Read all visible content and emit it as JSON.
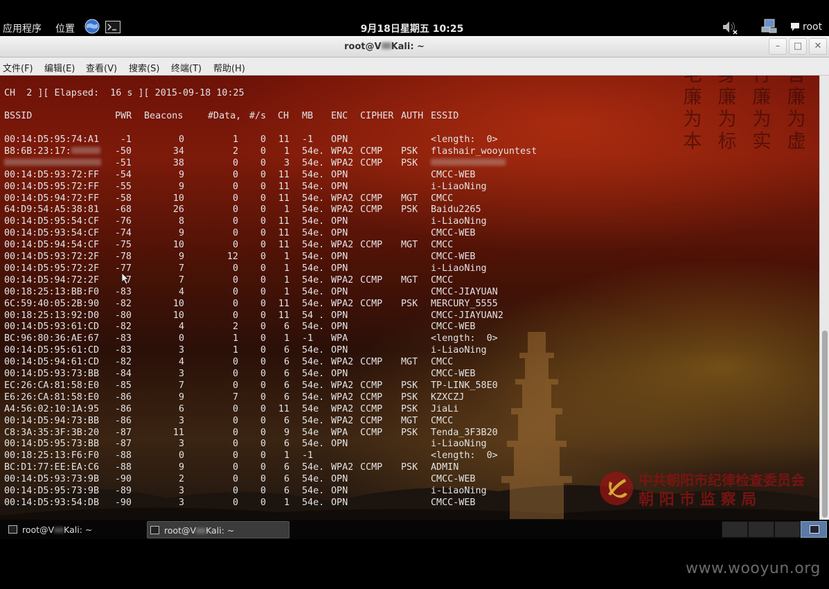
{
  "top_panel": {
    "apps_label": "应用程序",
    "places_label": "位置",
    "clock": "9月18日星期五 10:25",
    "user": "root",
    "icons": [
      "browser-globe-icon",
      "terminal-launcher-icon",
      "volume-muted-icon",
      "network-icon",
      "chat-icon"
    ]
  },
  "window": {
    "title_prefix": "root@V",
    "title_suffix": "Kali: ~",
    "buttons": {
      "minimize": "–",
      "maximize": "□",
      "close": "✕"
    }
  },
  "menu": [
    "文件(F)",
    "编辑(E)",
    "查看(V)",
    "搜索(S)",
    "终端(T)",
    "帮助(H)"
  ],
  "terminal": {
    "status_line": "CH  2 ][ Elapsed:  16 s ][ 2015-09-18 10:25",
    "headers": {
      "bssid": "BSSID",
      "pwr": "PWR",
      "beacons": "Beacons",
      "data": "#Data,",
      "rate": "#/s",
      "ch": "CH",
      "mb": "MB",
      "enc": "ENC",
      "cipher": "CIPHER",
      "auth": "AUTH",
      "essid": "ESSID"
    },
    "rows": [
      {
        "bssid": "00:14:D5:95:74:A1",
        "pwr": "-1",
        "beacons": "0",
        "data": "1",
        "rate": "0",
        "ch": "11",
        "mb": "-1",
        "enc": "OPN",
        "cipher": "",
        "auth": "",
        "essid": "<length:  0>"
      },
      {
        "bssid": "B8:6B:23:17:",
        "bssid_blur": true,
        "pwr": "-50",
        "beacons": "34",
        "data": "2",
        "rate": "0",
        "ch": "1",
        "mb": "54e.",
        "enc": "WPA2",
        "cipher": "CCMP",
        "auth": "PSK",
        "essid": "flashair_wooyuntest"
      },
      {
        "bssid": "",
        "bssid_blur": true,
        "pwr": "-51",
        "beacons": "38",
        "data": "0",
        "rate": "0",
        "ch": "3",
        "mb": "54e.",
        "enc": "WPA2",
        "cipher": "CCMP",
        "auth": "PSK",
        "essid": "",
        "essid_blur": true
      },
      {
        "bssid": "00:14:D5:93:72:FF",
        "pwr": "-54",
        "beacons": "9",
        "data": "0",
        "rate": "0",
        "ch": "11",
        "mb": "54e.",
        "enc": "OPN",
        "cipher": "",
        "auth": "",
        "essid": "CMCC-WEB"
      },
      {
        "bssid": "00:14:D5:95:72:FF",
        "pwr": "-55",
        "beacons": "9",
        "data": "0",
        "rate": "0",
        "ch": "11",
        "mb": "54e.",
        "enc": "OPN",
        "cipher": "",
        "auth": "",
        "essid": "i-LiaoNing"
      },
      {
        "bssid": "00:14:D5:94:72:FF",
        "pwr": "-58",
        "beacons": "10",
        "data": "0",
        "rate": "0",
        "ch": "11",
        "mb": "54e.",
        "enc": "WPA2",
        "cipher": "CCMP",
        "auth": "MGT",
        "essid": "CMCC"
      },
      {
        "bssid": "64:D9:54:A5:38:81",
        "pwr": "-68",
        "beacons": "26",
        "data": "0",
        "rate": "0",
        "ch": "1",
        "mb": "54e.",
        "enc": "WPA2",
        "cipher": "CCMP",
        "auth": "PSK",
        "essid": "Baidu2265"
      },
      {
        "bssid": "00:14:D5:95:54:CF",
        "pwr": "-76",
        "beacons": "8",
        "data": "0",
        "rate": "0",
        "ch": "11",
        "mb": "54e.",
        "enc": "OPN",
        "cipher": "",
        "auth": "",
        "essid": "i-LiaoNing"
      },
      {
        "bssid": "00:14:D5:93:54:CF",
        "pwr": "-74",
        "beacons": "9",
        "data": "0",
        "rate": "0",
        "ch": "11",
        "mb": "54e.",
        "enc": "OPN",
        "cipher": "",
        "auth": "",
        "essid": "CMCC-WEB"
      },
      {
        "bssid": "00:14:D5:94:54:CF",
        "pwr": "-75",
        "beacons": "10",
        "data": "0",
        "rate": "0",
        "ch": "11",
        "mb": "54e.",
        "enc": "WPA2",
        "cipher": "CCMP",
        "auth": "MGT",
        "essid": "CMCC"
      },
      {
        "bssid": "00:14:D5:93:72:2F",
        "pwr": "-78",
        "beacons": "9",
        "data": "12",
        "rate": "0",
        "ch": "1",
        "mb": "54e.",
        "enc": "OPN",
        "cipher": "",
        "auth": "",
        "essid": "CMCC-WEB"
      },
      {
        "bssid": "00:14:D5:95:72:2F",
        "pwr": "-77",
        "beacons": "7",
        "data": "0",
        "rate": "0",
        "ch": "1",
        "mb": "54e.",
        "enc": "OPN",
        "cipher": "",
        "auth": "",
        "essid": "i-LiaoNing"
      },
      {
        "bssid": "00:14:D5:94:72:2F",
        "pwr": "-7",
        "beacons": "7",
        "data": "0",
        "rate": "0",
        "ch": "1",
        "mb": "54e.",
        "enc": "WPA2",
        "cipher": "CCMP",
        "auth": "MGT",
        "essid": "CMCC"
      },
      {
        "bssid": "00:18:25:13:BB:F0",
        "pwr": "-83",
        "beacons": "4",
        "data": "0",
        "rate": "0",
        "ch": "1",
        "mb": "54e.",
        "enc": "OPN",
        "cipher": "",
        "auth": "",
        "essid": "CMCC-JIAYUAN"
      },
      {
        "bssid": "6C:59:40:05:2B:90",
        "pwr": "-82",
        "beacons": "10",
        "data": "0",
        "rate": "0",
        "ch": "11",
        "mb": "54e.",
        "enc": "WPA2",
        "cipher": "CCMP",
        "auth": "PSK",
        "essid": "MERCURY_5555"
      },
      {
        "bssid": "00:18:25:13:92:D0",
        "pwr": "-80",
        "beacons": "10",
        "data": "0",
        "rate": "0",
        "ch": "11",
        "mb": "54 .",
        "enc": "OPN",
        "cipher": "",
        "auth": "",
        "essid": "CMCC-JIAYUAN2"
      },
      {
        "bssid": "00:14:D5:93:61:CD",
        "pwr": "-82",
        "beacons": "4",
        "data": "2",
        "rate": "0",
        "ch": "6",
        "mb": "54e.",
        "enc": "OPN",
        "cipher": "",
        "auth": "",
        "essid": "CMCC-WEB"
      },
      {
        "bssid": "BC:96:80:36:AE:67",
        "pwr": "-83",
        "beacons": "0",
        "data": "1",
        "rate": "0",
        "ch": "1",
        "mb": "-1",
        "enc": "WPA",
        "cipher": "",
        "auth": "",
        "essid": "<length:  0>"
      },
      {
        "bssid": "00:14:D5:95:61:CD",
        "pwr": "-83",
        "beacons": "3",
        "data": "1",
        "rate": "0",
        "ch": "6",
        "mb": "54e.",
        "enc": "OPN",
        "cipher": "",
        "auth": "",
        "essid": "i-LiaoNing"
      },
      {
        "bssid": "00:14:D5:94:61:CD",
        "pwr": "-82",
        "beacons": "4",
        "data": "0",
        "rate": "0",
        "ch": "6",
        "mb": "54e.",
        "enc": "WPA2",
        "cipher": "CCMP",
        "auth": "MGT",
        "essid": "CMCC"
      },
      {
        "bssid": "00:14:D5:93:73:BB",
        "pwr": "-84",
        "beacons": "3",
        "data": "0",
        "rate": "0",
        "ch": "6",
        "mb": "54e.",
        "enc": "OPN",
        "cipher": "",
        "auth": "",
        "essid": "CMCC-WEB"
      },
      {
        "bssid": "EC:26:CA:81:58:E0",
        "pwr": "-85",
        "beacons": "7",
        "data": "0",
        "rate": "0",
        "ch": "6",
        "mb": "54e.",
        "enc": "WPA2",
        "cipher": "CCMP",
        "auth": "PSK",
        "essid": "TP-LINK_58E0"
      },
      {
        "bssid": "E6:26:CA:81:58:E0",
        "pwr": "-86",
        "beacons": "9",
        "data": "7",
        "rate": "0",
        "ch": "6",
        "mb": "54e.",
        "enc": "WPA2",
        "cipher": "CCMP",
        "auth": "PSK",
        "essid": "KZXCZJ"
      },
      {
        "bssid": "A4:56:02:10:1A:95",
        "pwr": "-86",
        "beacons": "6",
        "data": "0",
        "rate": "0",
        "ch": "11",
        "mb": "54e",
        "enc": "WPA2",
        "cipher": "CCMP",
        "auth": "PSK",
        "essid": "JiaLi"
      },
      {
        "bssid": "00:14:D5:94:73:BB",
        "pwr": "-86",
        "beacons": "3",
        "data": "0",
        "rate": "0",
        "ch": "6",
        "mb": "54e.",
        "enc": "WPA2",
        "cipher": "CCMP",
        "auth": "MGT",
        "essid": "CMCC"
      },
      {
        "bssid": "C8:3A:35:3F:3B:20",
        "pwr": "-87",
        "beacons": "11",
        "data": "0",
        "rate": "0",
        "ch": "9",
        "mb": "54e",
        "enc": "WPA",
        "cipher": "CCMP",
        "auth": "PSK",
        "essid": "Tenda_3F3B20"
      },
      {
        "bssid": "00:14:D5:95:73:BB",
        "pwr": "-87",
        "beacons": "3",
        "data": "0",
        "rate": "0",
        "ch": "6",
        "mb": "54e.",
        "enc": "OPN",
        "cipher": "",
        "auth": "",
        "essid": "i-LiaoNing"
      },
      {
        "bssid": "00:18:25:13:F6:F0",
        "pwr": "-88",
        "beacons": "0",
        "data": "0",
        "rate": "0",
        "ch": "1",
        "mb": "-1",
        "enc": "",
        "cipher": "",
        "auth": "",
        "essid": "<length:  0>"
      },
      {
        "bssid": "BC:D1:77:EE:EA:C6",
        "pwr": "-88",
        "beacons": "9",
        "data": "0",
        "rate": "0",
        "ch": "6",
        "mb": "54e.",
        "enc": "WPA2",
        "cipher": "CCMP",
        "auth": "PSK",
        "essid": "ADMIN"
      },
      {
        "bssid": "00:14:D5:93:73:9B",
        "pwr": "-90",
        "beacons": "2",
        "data": "0",
        "rate": "0",
        "ch": "6",
        "mb": "54e.",
        "enc": "OPN",
        "cipher": "",
        "auth": "",
        "essid": "CMCC-WEB"
      },
      {
        "bssid": "00:14:D5:95:73:9B",
        "pwr": "-89",
        "beacons": "3",
        "data": "0",
        "rate": "0",
        "ch": "6",
        "mb": "54e.",
        "enc": "OPN",
        "cipher": "",
        "auth": "",
        "essid": "i-LiaoNing"
      },
      {
        "bssid": "00:14:D5:93:54:DB",
        "pwr": "-90",
        "beacons": "3",
        "data": "0",
        "rate": "0",
        "ch": "1",
        "mb": "54e.",
        "enc": "OPN",
        "cipher": "",
        "auth": "",
        "essid": "CMCC-WEB"
      }
    ]
  },
  "wallpaper": {
    "poster_columns": [
      [
        "毛",
        "廉",
        "为",
        "本"
      ],
      [
        "身",
        "廉",
        "为",
        "标"
      ],
      [
        "行",
        "廉",
        "为",
        "实"
      ],
      [
        "言",
        "廉",
        "为",
        "虚"
      ]
    ],
    "org_line1": "中共朝阳市纪律检查委员会",
    "org_line2": "朝 阳 市 监 察 局"
  },
  "taskbar": {
    "tasks": [
      {
        "prefix": "root@V",
        "suffix": "Kali: ~",
        "active": false
      },
      {
        "prefix": "root@V",
        "suffix": "Kali: ~",
        "active": true
      }
    ]
  },
  "watermark": "www.wooyun.org",
  "colors": {
    "terminal_text": "#e2e2e2",
    "panel_bg": "#000000",
    "menu_bg": "#ececec",
    "wallpaper_red": "#7d1a0a"
  }
}
